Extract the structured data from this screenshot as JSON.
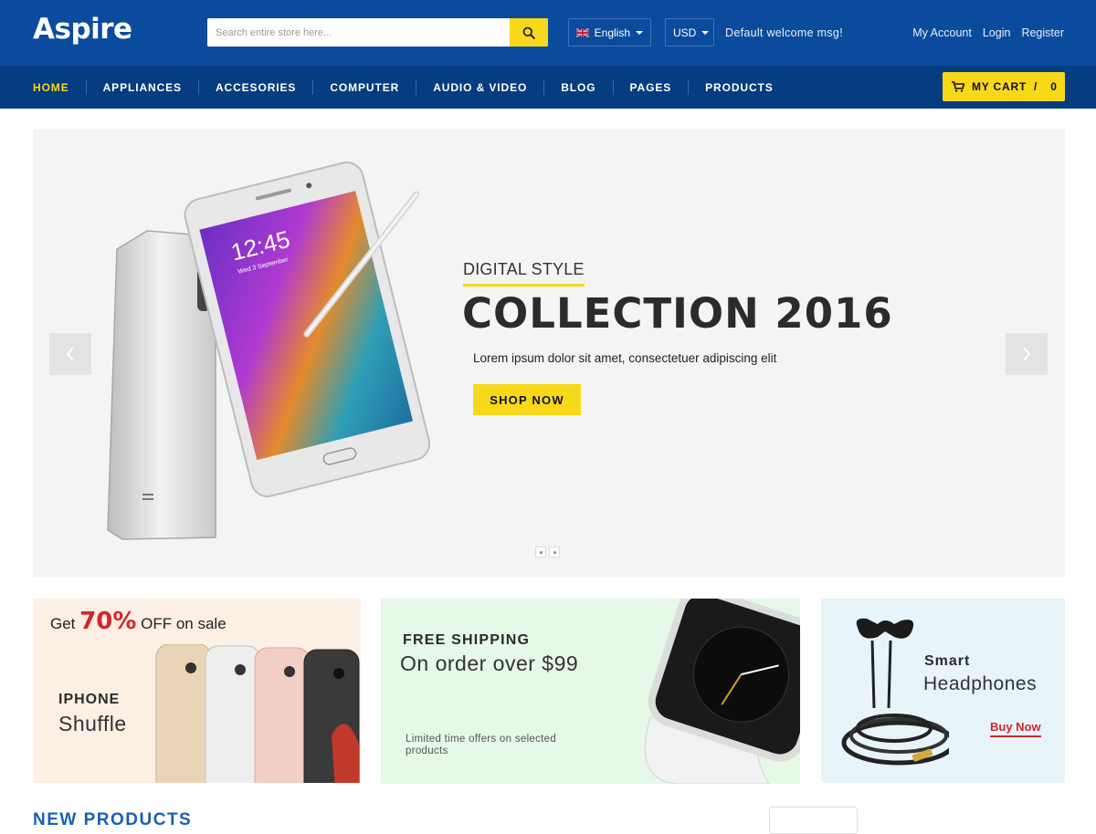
{
  "header": {
    "logo": "Aspire",
    "search_placeholder": "Search entire store here...",
    "language": "English",
    "currency": "USD",
    "welcome": "Default welcome msg!",
    "links": [
      "My Account",
      "Login",
      "Register"
    ]
  },
  "nav": {
    "items": [
      "HOME",
      "APPLIANCES",
      "ACCESORIES",
      "COMPUTER",
      "AUDIO & VIDEO",
      "BLOG",
      "PAGES",
      "PRODUCTS"
    ],
    "active_index": 0,
    "cart_label": "MY CART",
    "cart_sep": "/",
    "cart_count": "0"
  },
  "hero": {
    "subtitle": "DIGITAL STYLE",
    "title": "COLLECTION 2016",
    "description": "Lorem ipsum dolor sit amet, consectetuer adipiscing elit",
    "button": "SHOP NOW",
    "phone_time": "12:45",
    "phone_date": "Wed 3 September"
  },
  "banners": {
    "b1": {
      "promo_pre": "Get",
      "promo_value": "70%",
      "promo_post": "OFF on sale",
      "line1": "IPHONE",
      "line2": "Shuffle"
    },
    "b2": {
      "line1": "FREE SHIPPING",
      "line2": "On order over $99",
      "line3": "Limited time offers on selected products"
    },
    "b3": {
      "line1": "Smart",
      "line2": "Headphones",
      "link": "Buy Now"
    }
  },
  "section": {
    "title": "NEW PRODUCTS"
  },
  "colors": {
    "header_blue": "#0a4b9d",
    "nav_blue": "#063c80",
    "accent_yellow": "#f8d81b",
    "sale_red": "#d4252f"
  },
  "icons": [
    "search-icon",
    "uk-flag-icon",
    "cart-icon",
    "chevron-left-icon",
    "chevron-right-icon"
  ]
}
